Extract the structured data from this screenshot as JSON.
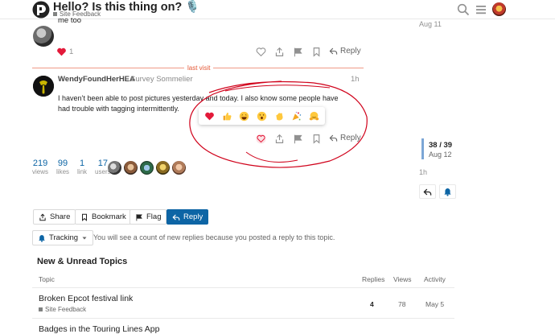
{
  "header": {
    "title": "Hello? Is this thing on? 🎙️",
    "category": "Site Feedback",
    "category_color": "#808281"
  },
  "prev_post": {
    "body": "me too",
    "like_count": "1",
    "reply_label": "Reply"
  },
  "last_visit_label": "last visit",
  "post": {
    "username": "WendyFoundHerHEA",
    "user_title": "Survey Sommelier",
    "date": "1h",
    "body": "I haven’t been able to post pictures yesterday and today. I also know some people have had trouble with tagging intermittently.",
    "reply_label": "Reply",
    "reactions": [
      "heart",
      "thumbs-up",
      "laughing",
      "open-mouth",
      "clap",
      "confetti",
      "hugs"
    ]
  },
  "stats": [
    {
      "n": "219",
      "label": "views"
    },
    {
      "n": "99",
      "label": "likes"
    },
    {
      "n": "1",
      "label": "link"
    },
    {
      "n": "17",
      "label": "users"
    }
  ],
  "timeline": {
    "top_date": "Aug 11",
    "position": "38 / 39",
    "position_date": "Aug 12",
    "bottom": "1h"
  },
  "controls": {
    "share": "Share",
    "bookmark": "Bookmark",
    "flag": "Flag",
    "reply": "Reply"
  },
  "tracking": {
    "label": "Tracking",
    "text": "You will see a count of new replies because you posted a reply to this topic."
  },
  "new_unread": {
    "title": "New & Unread Topics",
    "headers": {
      "topic": "Topic",
      "replies": "Replies",
      "views": "Views",
      "activity": "Activity"
    },
    "rows": [
      {
        "title": "Broken Epcot festival link",
        "category": "Site Feedback",
        "replies": "4",
        "views": "78",
        "activity": "May 5"
      },
      {
        "title": "Badges in the Touring Lines App",
        "category": "",
        "replies": "",
        "views": "",
        "activity": ""
      }
    ]
  },
  "colors": {
    "accent": "#0d65a5",
    "like": "#e31a3a",
    "last_visit": "#e45735",
    "annotation": "#d0021b"
  }
}
